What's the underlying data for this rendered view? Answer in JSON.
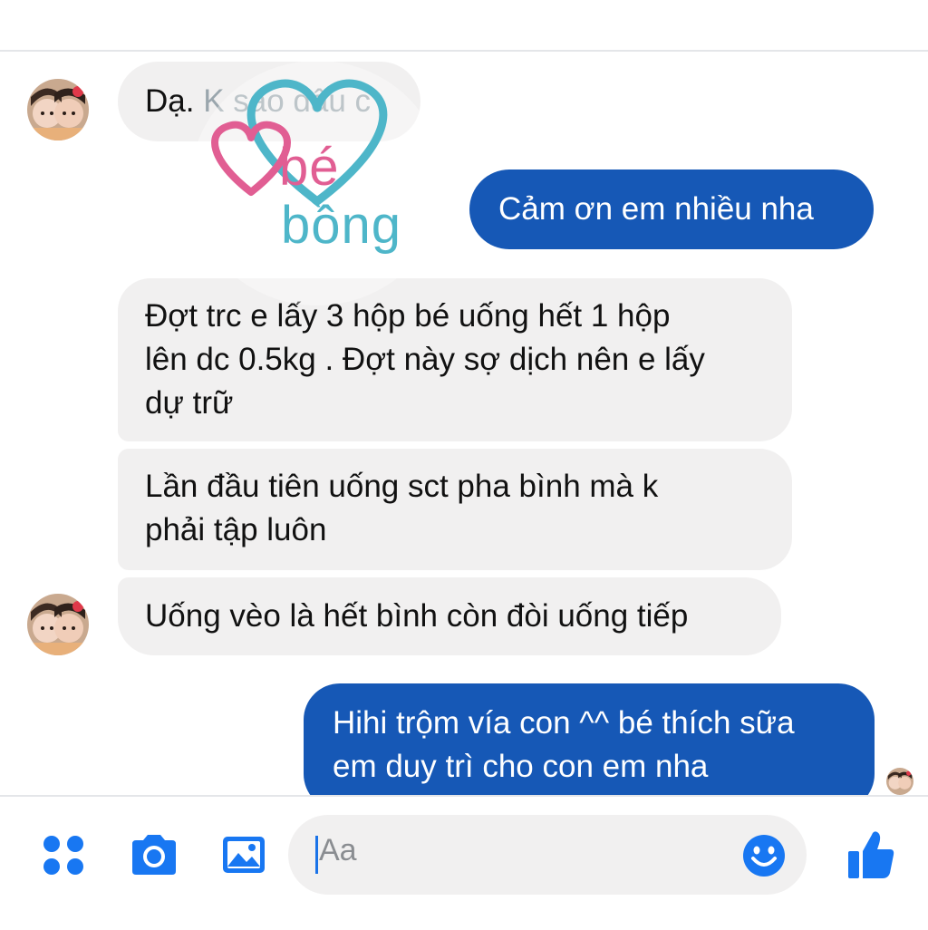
{
  "logo": {
    "line1": "bé",
    "line2": "bồng"
  },
  "messages": [
    {
      "id": "m1",
      "direction": "incoming",
      "text_main": "Dạ.",
      "text_rest": " K sao đâu c"
    },
    {
      "id": "m2",
      "direction": "outgoing",
      "text": "Cảm ơn em nhiều nha"
    },
    {
      "id": "m3",
      "direction": "incoming",
      "lines": [
        "Đợt trc e lấy 3 hộp bé uống hết 1 hộp",
        "lên dc 0.5kg . Đợt này sợ dịch nên e lấy",
        "dự trữ"
      ]
    },
    {
      "id": "m4",
      "direction": "incoming",
      "lines": [
        "Lần đầu tiên uống sct pha bình mà k",
        "phải tập luôn"
      ]
    },
    {
      "id": "m5",
      "direction": "incoming",
      "text": "Uống vèo là hết bình còn đòi uống tiếp"
    },
    {
      "id": "m6",
      "direction": "outgoing",
      "lines": [
        "Hihi trộm vía con ^^ bé thích sữa",
        "em duy trì cho con em nha"
      ]
    }
  ],
  "composer": {
    "placeholder": "Aa"
  },
  "icons": {
    "apps": "grid-dots-icon",
    "camera": "camera-icon",
    "gallery": "image-icon",
    "emoji": "smiley-icon",
    "like": "thumbs-up-icon"
  },
  "colors": {
    "accent": "#1877f2",
    "outgoing_bubble": "#1658b6",
    "incoming_bubble": "#f1f0f0",
    "logo_pink": "#e15e93",
    "logo_teal": "#4eb6c9"
  }
}
